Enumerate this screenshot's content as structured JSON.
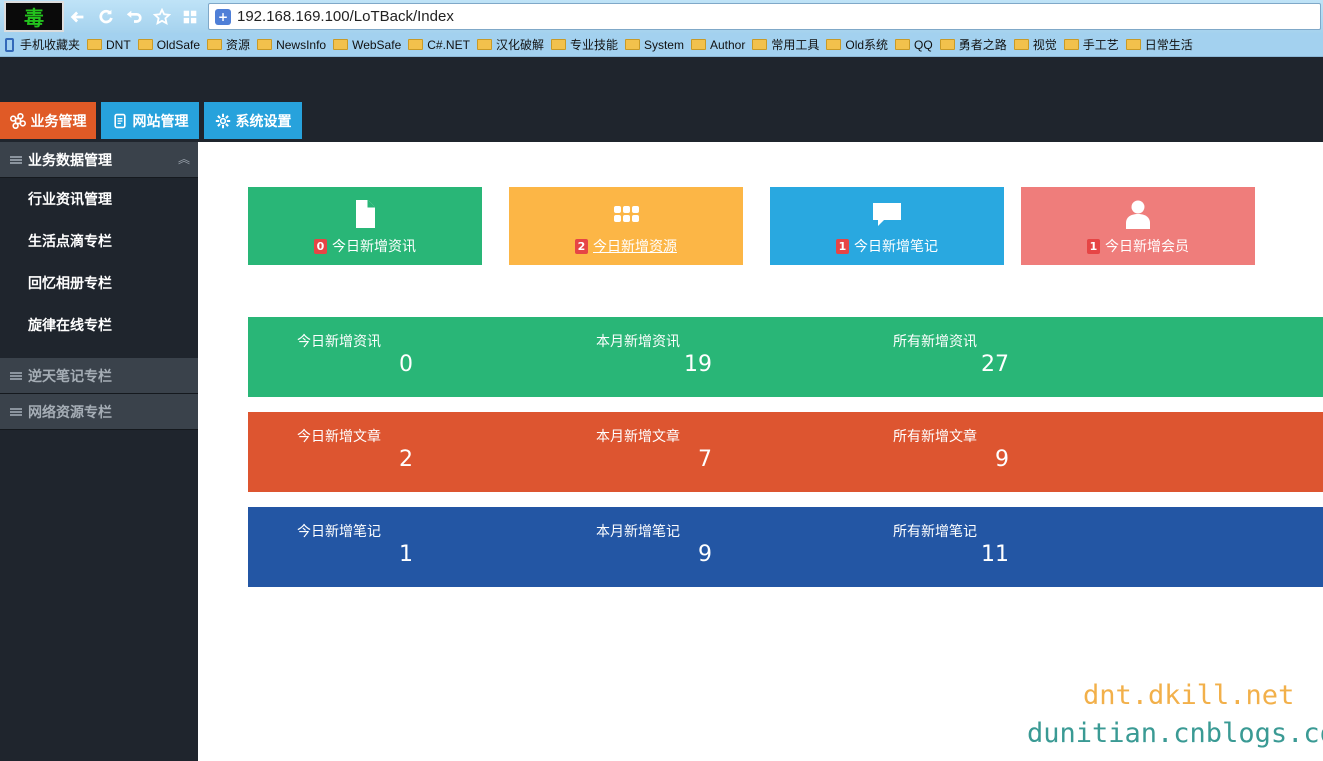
{
  "browser": {
    "logo_text": "毒",
    "url": "192.168.169.100/LoTBack/Index",
    "bookmarks": [
      "手机收藏夹",
      "DNT",
      "OldSafe",
      "资源",
      "NewsInfo",
      "WebSafe",
      "C#.NET",
      "汉化破解",
      "专业技能",
      "System",
      "Author",
      "常用工具",
      "Old系统",
      "QQ",
      "勇者之路",
      "视觉",
      "手工艺",
      "日常生活"
    ]
  },
  "top_nav": {
    "tabs": [
      {
        "label": "业务管理",
        "icon": "command-icon",
        "color": "#e05a26"
      },
      {
        "label": "网站管理",
        "icon": "document-icon",
        "color": "#27a2dc"
      },
      {
        "label": "系统设置",
        "icon": "gear-icon",
        "color": "#27a2dc"
      }
    ]
  },
  "sidebar": {
    "group_active": "业务数据管理",
    "items": [
      "行业资讯管理",
      "生活点滴专栏",
      "回忆相册专栏",
      "旋律在线专栏"
    ],
    "group_2": "逆天笔记专栏",
    "group_3": "网络资源专栏"
  },
  "tiles": [
    {
      "count": "0",
      "label": "今日新增资讯",
      "color": "#29b677",
      "icon": "file-icon"
    },
    {
      "count": "2",
      "label": "今日新增资源",
      "color": "#fcb646",
      "icon": "grid-icon"
    },
    {
      "count": "1",
      "label": "今日新增笔记",
      "color": "#29a8e0",
      "icon": "comment-icon"
    },
    {
      "count": "1",
      "label": "今日新增会员",
      "color": "#ef7d7b",
      "icon": "user-icon"
    }
  ],
  "stats": [
    {
      "color": "#29b677",
      "items": [
        {
          "label": "今日新增资讯",
          "value": "0"
        },
        {
          "label": "本月新增资讯",
          "value": "19"
        },
        {
          "label": "所有新增资讯",
          "value": "27"
        }
      ]
    },
    {
      "color": "#dd5530",
      "items": [
        {
          "label": "今日新增文章",
          "value": "2"
        },
        {
          "label": "本月新增文章",
          "value": "7"
        },
        {
          "label": "所有新增文章",
          "value": "9"
        }
      ]
    },
    {
      "color": "#2356a4",
      "items": [
        {
          "label": "今日新增笔记",
          "value": "1"
        },
        {
          "label": "本月新增笔记",
          "value": "9"
        },
        {
          "label": "所有新增笔记",
          "value": "11"
        }
      ]
    }
  ],
  "watermark": {
    "line1": "dnt.dkill.net",
    "line2": "dunitian.cnblogs.com"
  }
}
